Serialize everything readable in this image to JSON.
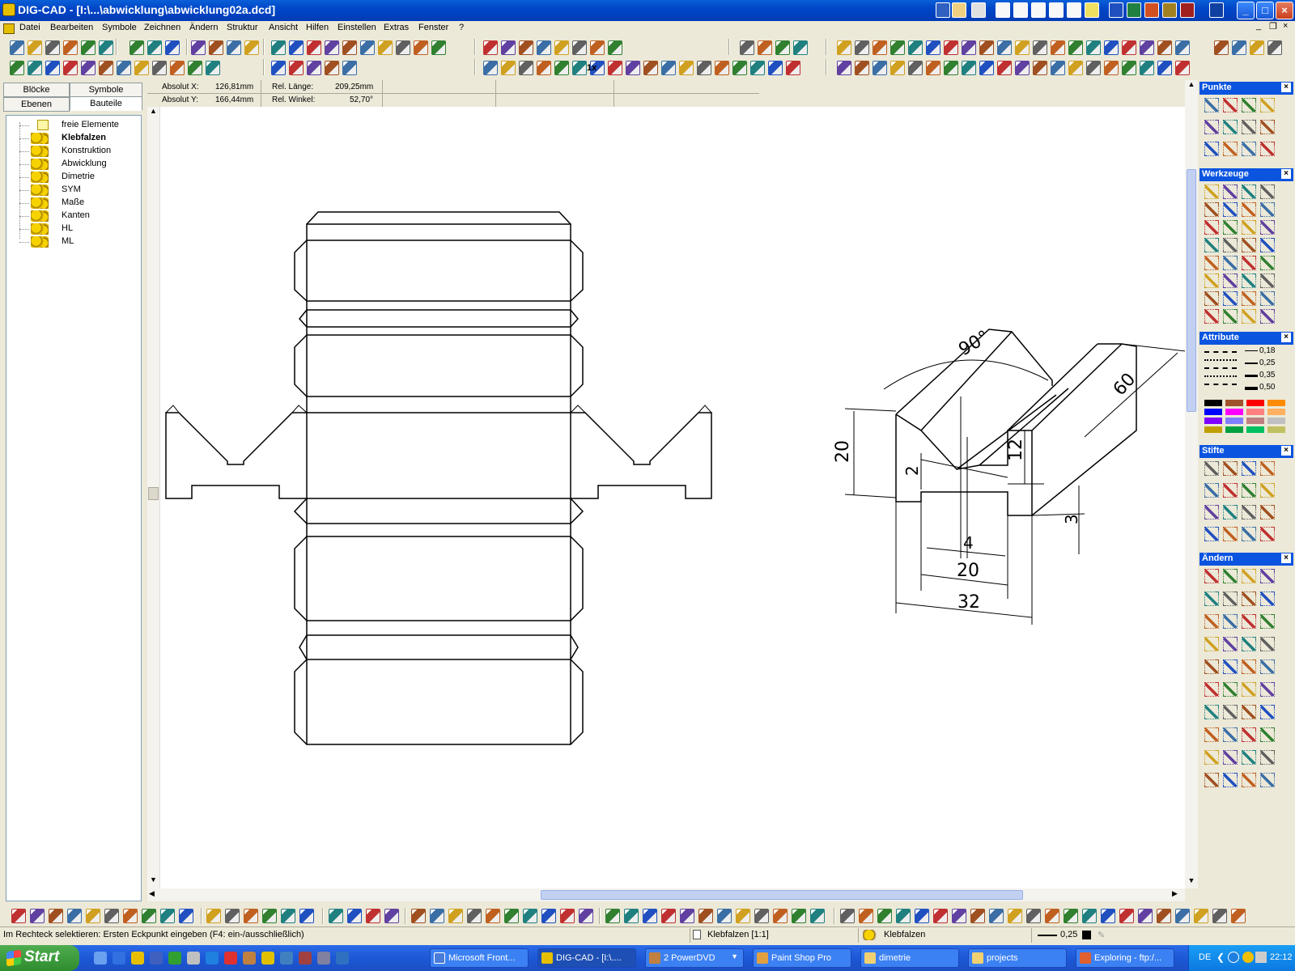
{
  "window": {
    "title": "DIG-CAD - [I:\\...\\abwicklung\\abwicklung02a.dcd]"
  },
  "menu": [
    "Datei",
    "Bearbeiten",
    "Symbole",
    "Zeichnen",
    "Ändern",
    "Struktur",
    "Ansicht",
    "Hilfen",
    "Einstellen",
    "Extras",
    "Fenster",
    "?"
  ],
  "left_tabs": {
    "bloecke": "Blöcke",
    "symbole": "Symbole",
    "ebenen": "Ebenen",
    "bauteile": "Bauteile"
  },
  "tree": [
    {
      "label": "freie Elemente",
      "icon": "folder-icon",
      "bold": false
    },
    {
      "label": "Klebfalzen",
      "icon": "coins-icon",
      "bold": true
    },
    {
      "label": "Konstruktion",
      "icon": "coins-icon",
      "bold": false
    },
    {
      "label": "Abwicklung",
      "icon": "coins-icon",
      "bold": false
    },
    {
      "label": "Dimetrie",
      "icon": "coins-icon",
      "bold": false
    },
    {
      "label": "SYM",
      "icon": "coins-icon",
      "bold": false
    },
    {
      "label": "Maße",
      "icon": "coins-icon",
      "bold": false
    },
    {
      "label": "Kanten",
      "icon": "coins-icon",
      "bold": false
    },
    {
      "label": "HL",
      "icon": "coins-icon",
      "bold": false
    },
    {
      "label": "ML",
      "icon": "coins-icon",
      "bold": false
    }
  ],
  "coords": {
    "abs_x_label": "Absolut X:",
    "abs_x": "126,81mm",
    "abs_y_label": "Absolut Y:",
    "abs_y": "166,44mm",
    "rel_len_label": "Rel. Länge:",
    "rel_len": "209,25mm",
    "rel_angle_label": "Rel. Winkel:",
    "rel_angle": "52,70°"
  },
  "drawing": {
    "dims": {
      "angle": "90°",
      "d60": "60",
      "d20_left": "20",
      "d12": "12",
      "d2": "2",
      "d3": "3",
      "d4": "4",
      "d20_bottom": "20",
      "d32": "32"
    }
  },
  "panels": {
    "punkte": "Punkte",
    "werkzeuge": "Werkzeuge",
    "attribute": "Attribute",
    "stifte": "Stifte",
    "aendern": "Ändern",
    "close": "×"
  },
  "attributes": {
    "linewidths": [
      "0,18",
      "0,25",
      "0,35",
      "0,50"
    ],
    "swatches": [
      "#000000",
      "#a0522d",
      "#ff0000",
      "#ff8c00",
      "#0000ff",
      "#ff00ff",
      "#ff8080",
      "#ffb060",
      "#8000ff",
      "#8080ff",
      "#c08080",
      "#c0c0c0",
      "#c0a000",
      "#00a040",
      "#00c060",
      "#c0c060"
    ]
  },
  "toolbar1_text": "1x",
  "status": {
    "message": "Im Rechteck selektieren: Ersten Eckpunkt eingeben (F4: ein-/ausschließlich)",
    "layer": "Klebfalzen [1:1]",
    "part": "Klebfalzen",
    "linewidth": "0,25"
  },
  "taskbar": {
    "start": "Start",
    "tasks": [
      "Microsoft Front...",
      "DIG-CAD - [I:\\....",
      "2 PowerDVD",
      "Paint Shop Pro",
      "dimetrie",
      "projects",
      "Exploring - ftp:/..."
    ],
    "lang": "DE",
    "clock": "22:12"
  }
}
